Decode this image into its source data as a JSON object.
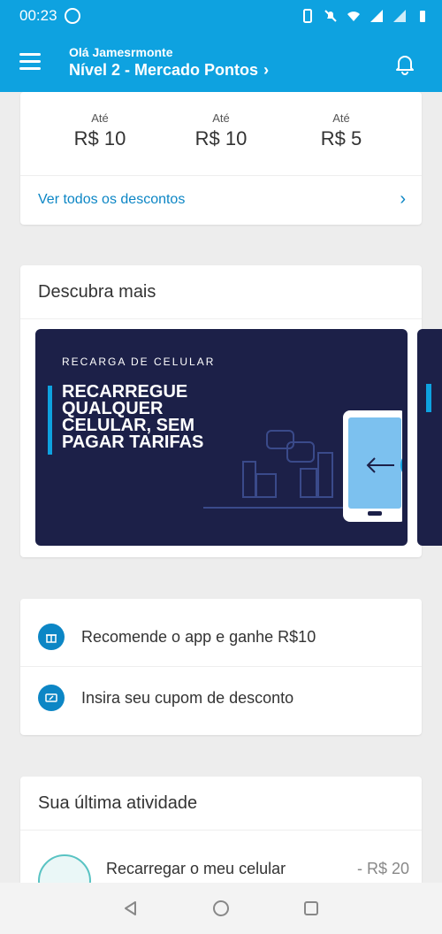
{
  "status": {
    "time": "00:23"
  },
  "header": {
    "greeting": "Olá Jamesrmonte",
    "level": "Nível 2 - Mercado Pontos",
    "level_chevron": "›"
  },
  "discounts": {
    "items": [
      {
        "label": "Até",
        "value": "R$ 10"
      },
      {
        "label": "Até",
        "value": "R$ 10"
      },
      {
        "label": "Até",
        "value": "R$ 5"
      }
    ],
    "see_all": "Ver todos os descontos",
    "see_all_chevron": "›"
  },
  "discover": {
    "title": "Descubra mais",
    "banner": {
      "kicker": "RECARGA DE CELULAR",
      "headline": "RECARREGUE QUALQUER CELULAR, SEM PAGAR TARIFAS"
    }
  },
  "links": [
    {
      "label": "Recomende o app e ganhe R$10",
      "icon": "gift-icon"
    },
    {
      "label": "Insira seu cupom de desconto",
      "icon": "coupon-icon"
    }
  ],
  "activity": {
    "title": "Sua última atividade",
    "items": [
      {
        "label": "Recarregar o meu celular",
        "value": "- R$ 20"
      }
    ]
  },
  "colors": {
    "brand": "#0ea2e0",
    "link": "#0c86c5",
    "banner": "#1c2048"
  }
}
